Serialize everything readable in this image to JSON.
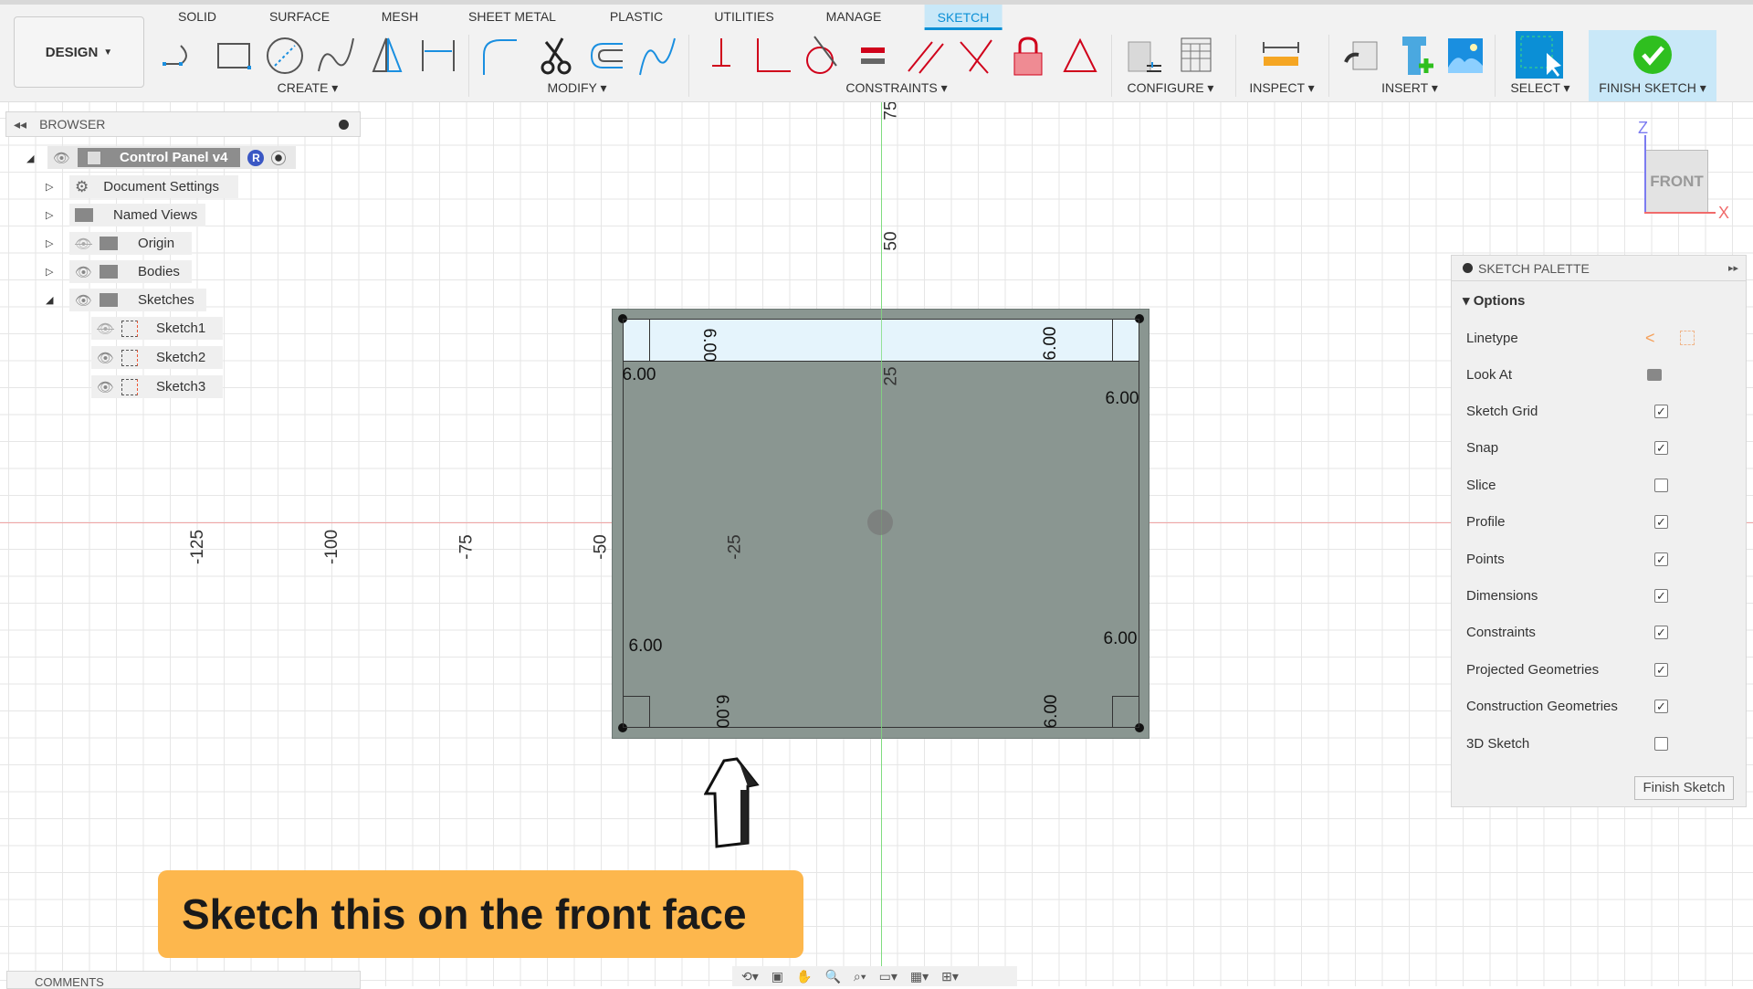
{
  "toolbar": {
    "workspace": "DESIGN",
    "tabs": [
      "SOLID",
      "SURFACE",
      "MESH",
      "SHEET METAL",
      "PLASTIC",
      "UTILITIES",
      "MANAGE",
      "SKETCH"
    ],
    "active_tab": "SKETCH",
    "groups": [
      "CREATE",
      "MODIFY",
      "CONSTRAINTS",
      "CONFIGURE",
      "INSPECT",
      "INSERT",
      "SELECT",
      "FINISH SKETCH"
    ]
  },
  "browser": {
    "title": "BROWSER",
    "root": "Control Panel v4",
    "root_badge": "R",
    "items": [
      "Document Settings",
      "Named Views",
      "Origin",
      "Bodies",
      "Sketches"
    ],
    "sketches": [
      "Sketch1",
      "Sketch2",
      "Sketch3"
    ]
  },
  "comments": {
    "title": "COMMENTS"
  },
  "viewcube": {
    "face": "FRONT",
    "z": "Z",
    "x": "X"
  },
  "axes": {
    "x_ticks": [
      "-125",
      "-100",
      "-75",
      "-50",
      "-25"
    ],
    "y_ticks": [
      "75",
      "50",
      "25"
    ]
  },
  "dimensions": [
    "6.00",
    "6.00",
    "6.00",
    "6.00",
    "6.00",
    "6.00",
    "6.00",
    "6.00"
  ],
  "palette": {
    "title": "SKETCH PALETTE",
    "section": "Options",
    "linetype": "Linetype",
    "lookat": "Look At",
    "options": [
      {
        "label": "Sketch Grid",
        "checked": true
      },
      {
        "label": "Snap",
        "checked": true
      },
      {
        "label": "Slice",
        "checked": false
      },
      {
        "label": "Profile",
        "checked": true
      },
      {
        "label": "Points",
        "checked": true
      },
      {
        "label": "Dimensions",
        "checked": true
      },
      {
        "label": "Constraints",
        "checked": true
      },
      {
        "label": "Projected Geometries",
        "checked": true
      },
      {
        "label": "Construction Geometries",
        "checked": true
      },
      {
        "label": "3D Sketch",
        "checked": false
      }
    ],
    "finish_button": "Finish Sketch"
  },
  "banner": {
    "text": "Sketch this on the front face"
  },
  "colors": {
    "accent": "#0b8fd6",
    "banner": "#fdb74d",
    "sketch_fill": "#8a9691",
    "finish_green": "#2fbf1f"
  }
}
